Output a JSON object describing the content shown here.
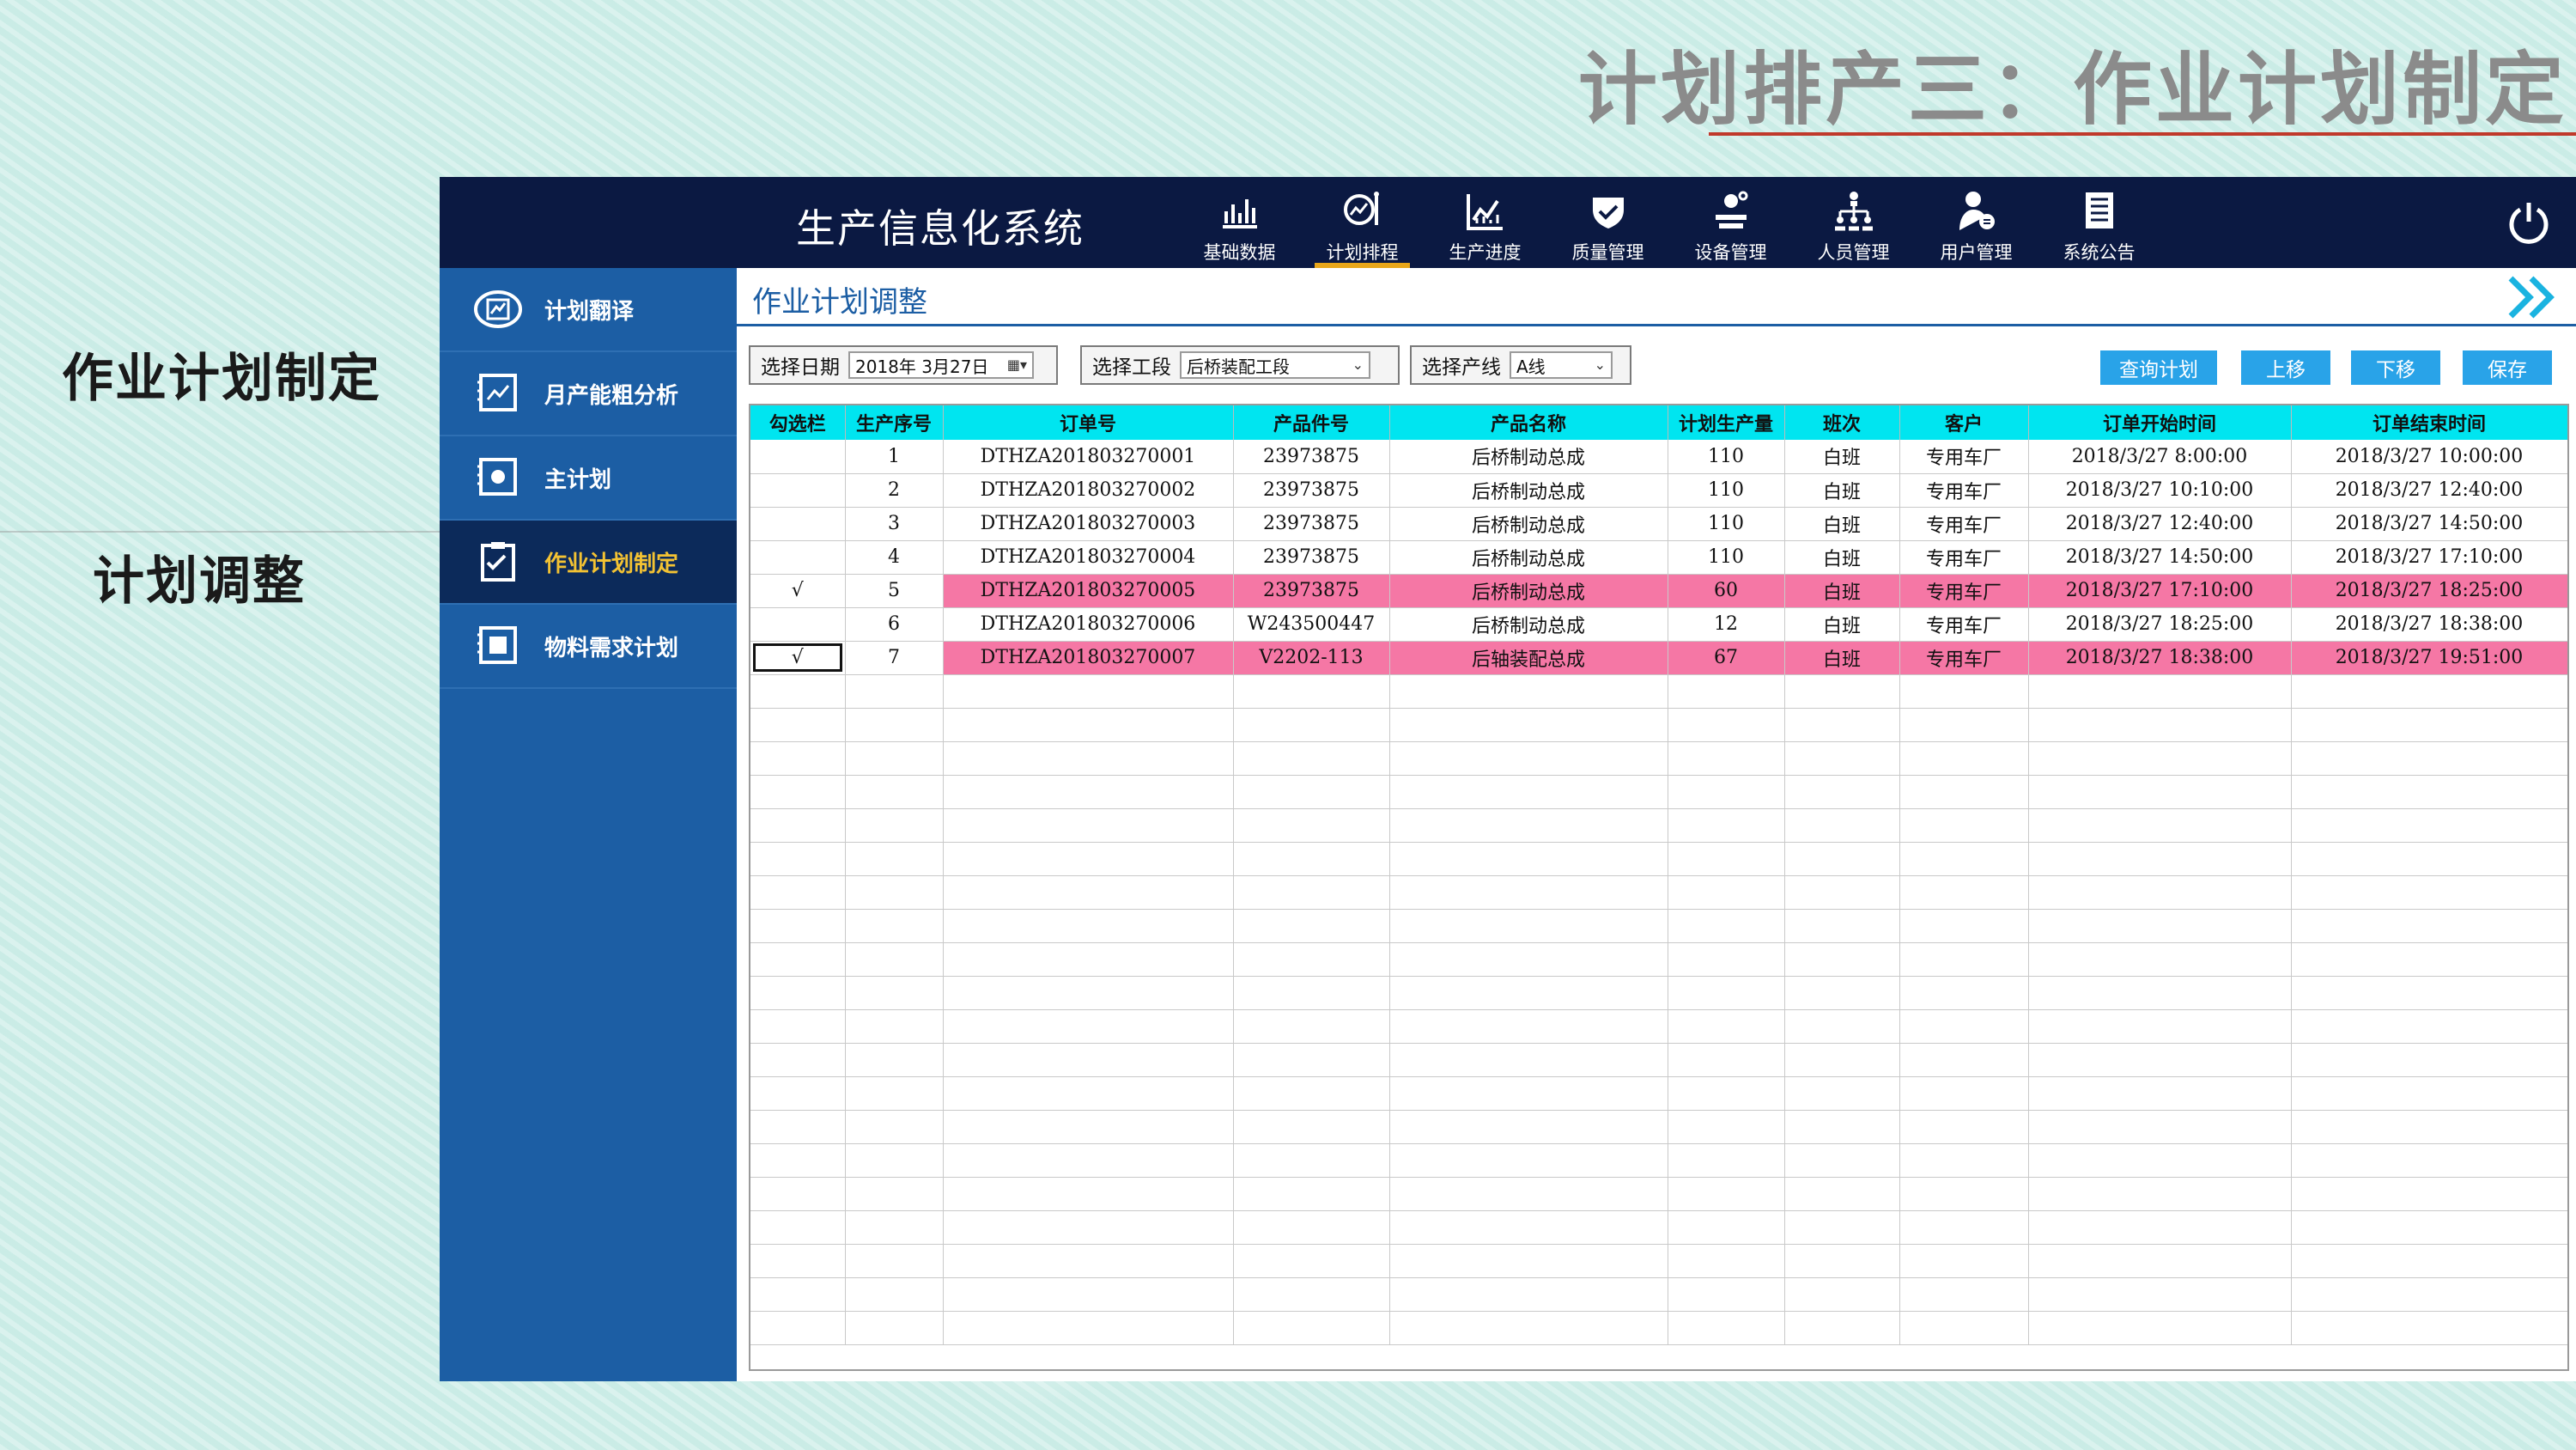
{
  "slide": {
    "title": "计划排产三：作业计划制定",
    "label_main": "作业计划制定",
    "label_sub": "计划调整"
  },
  "app": {
    "title": "生产信息化系统",
    "nav": [
      {
        "label": "基础数据",
        "icon": "chart-icon"
      },
      {
        "label": "计划排程",
        "icon": "plan-schedule-icon",
        "active": true
      },
      {
        "label": "生产进度",
        "icon": "progress-chart-icon"
      },
      {
        "label": "质量管理",
        "icon": "quality-shield-icon"
      },
      {
        "label": "设备管理",
        "icon": "equipment-icon"
      },
      {
        "label": "人员管理",
        "icon": "org-chart-icon"
      },
      {
        "label": "用户管理",
        "icon": "user-icon"
      },
      {
        "label": "系统公告",
        "icon": "notice-icon"
      }
    ]
  },
  "sidebar": {
    "items": [
      {
        "label": "计划翻译",
        "icon": "translate-icon",
        "active": false
      },
      {
        "label": "月产能粗分析",
        "icon": "capacity-icon",
        "active": false
      },
      {
        "label": "主计划",
        "icon": "master-plan-icon",
        "active": false
      },
      {
        "label": "作业计划制定",
        "icon": "task-plan-icon",
        "active": true
      },
      {
        "label": "物料需求计划",
        "icon": "material-icon",
        "active": false
      }
    ]
  },
  "content": {
    "title": "作业计划调整",
    "filters": {
      "date_label": "选择日期",
      "date_value": "2018年  3月27日",
      "section_label": "选择工段",
      "section_value": "后桥装配工段",
      "line_label": "选择产线",
      "line_value": "A线"
    },
    "buttons": {
      "query": "查询计划",
      "up": "上移",
      "down": "下移",
      "save": "保存"
    }
  },
  "table": {
    "columns": [
      "勾选栏",
      "生产序号",
      "订单号",
      "产品件号",
      "产品名称",
      "计划生产量",
      "班次",
      "客户",
      "订单开始时间",
      "订单结束时间"
    ],
    "rows": [
      {
        "check": "",
        "seq": "1",
        "order": "DTHZA201803270001",
        "part": "23973875",
        "name": "后桥制动总成",
        "qty": "110",
        "shift": "白班",
        "customer": "专用车厂",
        "start": "2018/3/27  8:00:00",
        "end": "2018/3/27  10:00:00",
        "highlight": false
      },
      {
        "check": "",
        "seq": "2",
        "order": "DTHZA201803270002",
        "part": "23973875",
        "name": "后桥制动总成",
        "qty": "110",
        "shift": "白班",
        "customer": "专用车厂",
        "start": "2018/3/27  10:10:00",
        "end": "2018/3/27  12:40:00",
        "highlight": false
      },
      {
        "check": "",
        "seq": "3",
        "order": "DTHZA201803270003",
        "part": "23973875",
        "name": "后桥制动总成",
        "qty": "110",
        "shift": "白班",
        "customer": "专用车厂",
        "start": "2018/3/27  12:40:00",
        "end": "2018/3/27  14:50:00",
        "highlight": false
      },
      {
        "check": "",
        "seq": "4",
        "order": "DTHZA201803270004",
        "part": "23973875",
        "name": "后桥制动总成",
        "qty": "110",
        "shift": "白班",
        "customer": "专用车厂",
        "start": "2018/3/27  14:50:00",
        "end": "2018/3/27  17:10:00",
        "highlight": false
      },
      {
        "check": "√",
        "seq": "5",
        "order": "DTHZA201803270005",
        "part": "23973875",
        "name": "后桥制动总成",
        "qty": "60",
        "shift": "白班",
        "customer": "专用车厂",
        "start": "2018/3/27  17:10:00",
        "end": "2018/3/27  18:25:00",
        "highlight": true
      },
      {
        "check": "",
        "seq": "6",
        "order": "DTHZA201803270006",
        "part": "W243500447",
        "name": "后桥制动总成",
        "qty": "12",
        "shift": "白班",
        "customer": "专用车厂",
        "start": "2018/3/27  18:25:00",
        "end": "2018/3/27  18:38:00",
        "highlight": false
      },
      {
        "check": "√",
        "seq": "7",
        "order": "DTHZA201803270007",
        "part": "V2202-113",
        "name": "后轴装配总成",
        "qty": "67",
        "shift": "白班",
        "customer": "专用车厂",
        "start": "2018/3/27  18:38:00",
        "end": "2018/3/27  19:51:00",
        "highlight": true
      }
    ],
    "empty_rows": 20
  },
  "colors": {
    "topbar": "#0b1942",
    "sidebar": "#1c5ea4",
    "active_sidebar": "#0c2a5a",
    "active_text": "#f3c233",
    "header_cyan": "#00e5f0",
    "highlight_pink": "#f577a5",
    "button_blue": "#29a3e8"
  }
}
